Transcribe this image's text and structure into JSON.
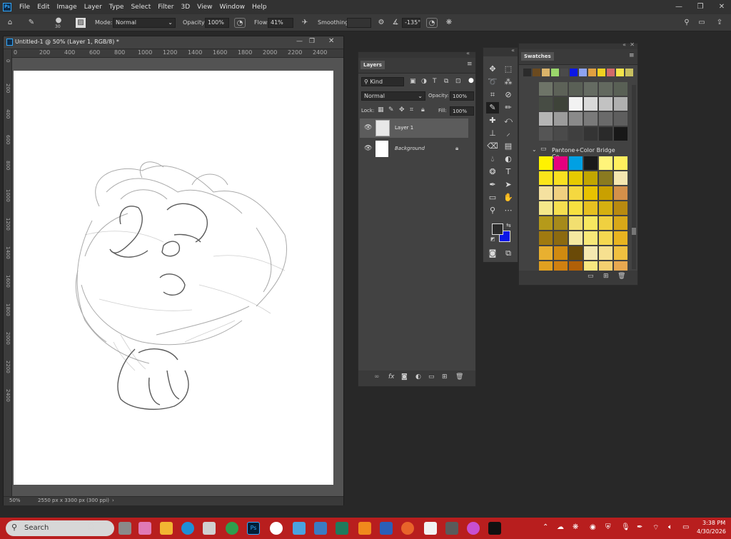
{
  "menu": {
    "items": [
      "File",
      "Edit",
      "Image",
      "Layer",
      "Type",
      "Select",
      "Filter",
      "3D",
      "View",
      "Window",
      "Help"
    ]
  },
  "options": {
    "brush_size": "30",
    "mode_label": "Mode:",
    "mode_value": "Normal",
    "opacity_label": "Opacity:",
    "opacity_value": "100%",
    "flow_label": "Flow:",
    "flow_value": "41%",
    "smoothing_label": "Smoothing:",
    "angle_value": "-135°"
  },
  "document": {
    "tab_title": "Untitled-1 @ 50% (Layer 1, RGB/8) *",
    "ruler_marks": [
      "0",
      "200",
      "400",
      "600",
      "800",
      "1000",
      "1200",
      "1400",
      "1600",
      "1800",
      "2000",
      "2200",
      "2400"
    ],
    "zoom": "50%",
    "size_info": "2550 px x 3300 px (300 ppi)"
  },
  "layers": {
    "tab": "Layers",
    "filter_kind": "Kind",
    "blend_mode": "Normal",
    "opacity_label": "Opacity:",
    "opacity_value": "100%",
    "lock_label": "Lock:",
    "fill_label": "Fill:",
    "fill_value": "100%",
    "items": [
      {
        "name": "Layer 1"
      },
      {
        "name": "Background"
      }
    ]
  },
  "swatches": {
    "tab": "Swatches",
    "group_name": "Pantone+Color Bridge Co..."
  },
  "taskbar": {
    "search_placeholder": "Search",
    "time": "3:38 PM",
    "date": "4/30/2026"
  },
  "colors": {
    "foreground": "#2b2b2b",
    "background": "#0a16e6",
    "accent": "#b81e1e"
  }
}
